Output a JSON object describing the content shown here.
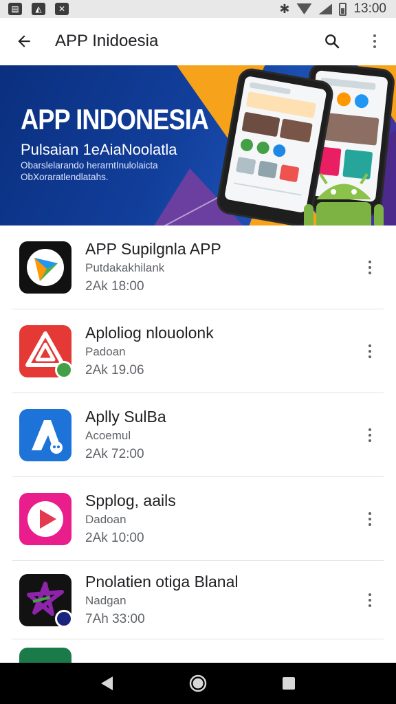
{
  "status_bar": {
    "time": "13:00",
    "notif_icons": [
      "notification-icon",
      "notification-icon",
      "notification-icon"
    ],
    "icons": [
      "bluetooth-icon",
      "wifi-icon",
      "signal-icon",
      "battery-icon"
    ]
  },
  "app_bar": {
    "title": "APP Inidoesia",
    "icons": [
      "back-arrow-icon",
      "search-icon",
      "more-vert-icon"
    ]
  },
  "banner": {
    "title": "APP INDONESIA",
    "subtitle": "Pulsaian 1eAiaNoolatla",
    "description": "Obarslelarando herarntInulolaicta ObXoraratlendlatahs.",
    "colors": {
      "bg": "#123f9c",
      "accent_orange": "#f6a21a",
      "accent_purple": "#6b3fa0",
      "android_green": "#8bc34a"
    }
  },
  "apps": [
    {
      "title": "APP Supilgnla APP",
      "subtitle": "Putdakakhilank",
      "time": "2Ak 18:00",
      "icon": "dark-play-triangle-icon",
      "color": "#111111"
    },
    {
      "title": "Aploliog nlouolonk",
      "subtitle": "Padoan",
      "time": "2Ak 19.06",
      "icon": "red-logo-icon",
      "color": "#e53935"
    },
    {
      "title": "Aplly SulBa",
      "subtitle": "Acoemul",
      "time": "2Ak 72:00",
      "icon": "blue-a-logo-icon",
      "color": "#1e73d8"
    },
    {
      "title": "Spplog, aails",
      "subtitle": "Dadoan",
      "time": "2Ak 10:00",
      "icon": "pink-play-icon",
      "color": "#e91e8c"
    },
    {
      "title": "Pnolatien otiga Blanal",
      "subtitle": "Nadgan",
      "time": "7Ah 33:00",
      "icon": "dark-star-logo-icon",
      "color": "#121212"
    }
  ],
  "nav_bar": {
    "icons": [
      "back-triangle-icon",
      "home-circle-icon",
      "recents-square-icon"
    ]
  }
}
